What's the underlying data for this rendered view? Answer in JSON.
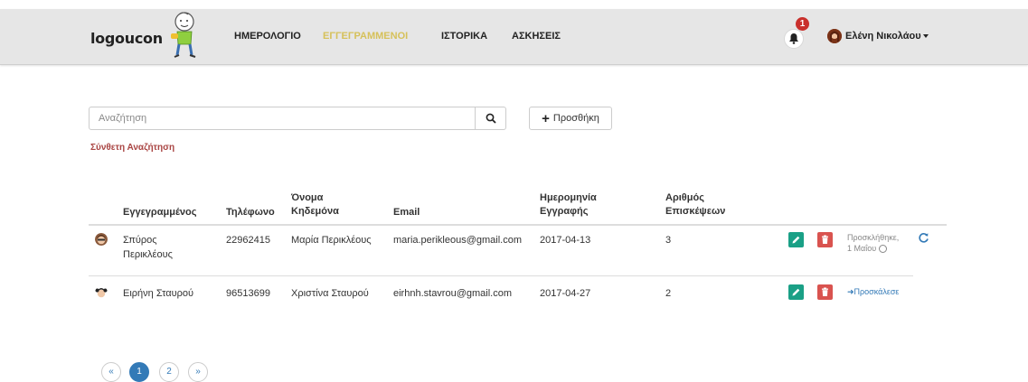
{
  "navbar": {
    "logo_text": "logoucon",
    "links": [
      "ΗΜΕΡΟΛΟΓΙΟ",
      "ΕΓΓΕΓΡΑΜΜΕΝΟΙ",
      "ΙΣΤΟΡΙΚΑ",
      "ΑΣΚΗΣΕΙΣ"
    ],
    "active_link": "ΕΓΓΕΓΡΑΜΜΕΝΟΙ",
    "notification_count": "1",
    "user_name": "Ελένη Νικολάου"
  },
  "search": {
    "placeholder": "Αναζήτηση",
    "add_label": "Προσθήκη",
    "advanced_label": "Σύνθετη Αναζήτηση"
  },
  "table": {
    "headers": {
      "registered": "Εγγεγραμμένος",
      "phone": "Τηλέφωνο",
      "guardian_1": "Όνομα",
      "guardian_2": "Κηδεμόνα",
      "email": "Email",
      "date_1": "Ημερομηνία",
      "date_2": "Εγγραφής",
      "visits_1": "Αριθμός",
      "visits_2": "Επισκέψεων"
    },
    "rows": [
      {
        "name_1": "Σπύρος",
        "name_2": "Περικλέους",
        "phone": "22962415",
        "guardian": "Μαρία Περικλέους",
        "email": "maria.perikleous@gmail.com",
        "date": "2017-04-13",
        "visits": "3",
        "status_1": "Προσκλήθηκε,",
        "status_2": "1 Μαΐου"
      },
      {
        "name_1": "Ειρήνη Σταυρού",
        "phone": "96513699",
        "guardian": "Χριστίνα Σταυρού",
        "email": "eirhnh.stavrou@gmail.com",
        "date": "2017-04-27",
        "visits": "2",
        "invite_label": "Προσκάλεσε"
      }
    ]
  },
  "pagination": {
    "prev": "«",
    "pages": [
      "1",
      "2"
    ],
    "current": "1",
    "next": "»"
  },
  "colors": {
    "active_nav": "#d6c15a",
    "edit": "#1aa086",
    "delete": "#d9534f",
    "link": "#337ab7",
    "advanced": "#a94442",
    "badge": "#c9302c"
  }
}
